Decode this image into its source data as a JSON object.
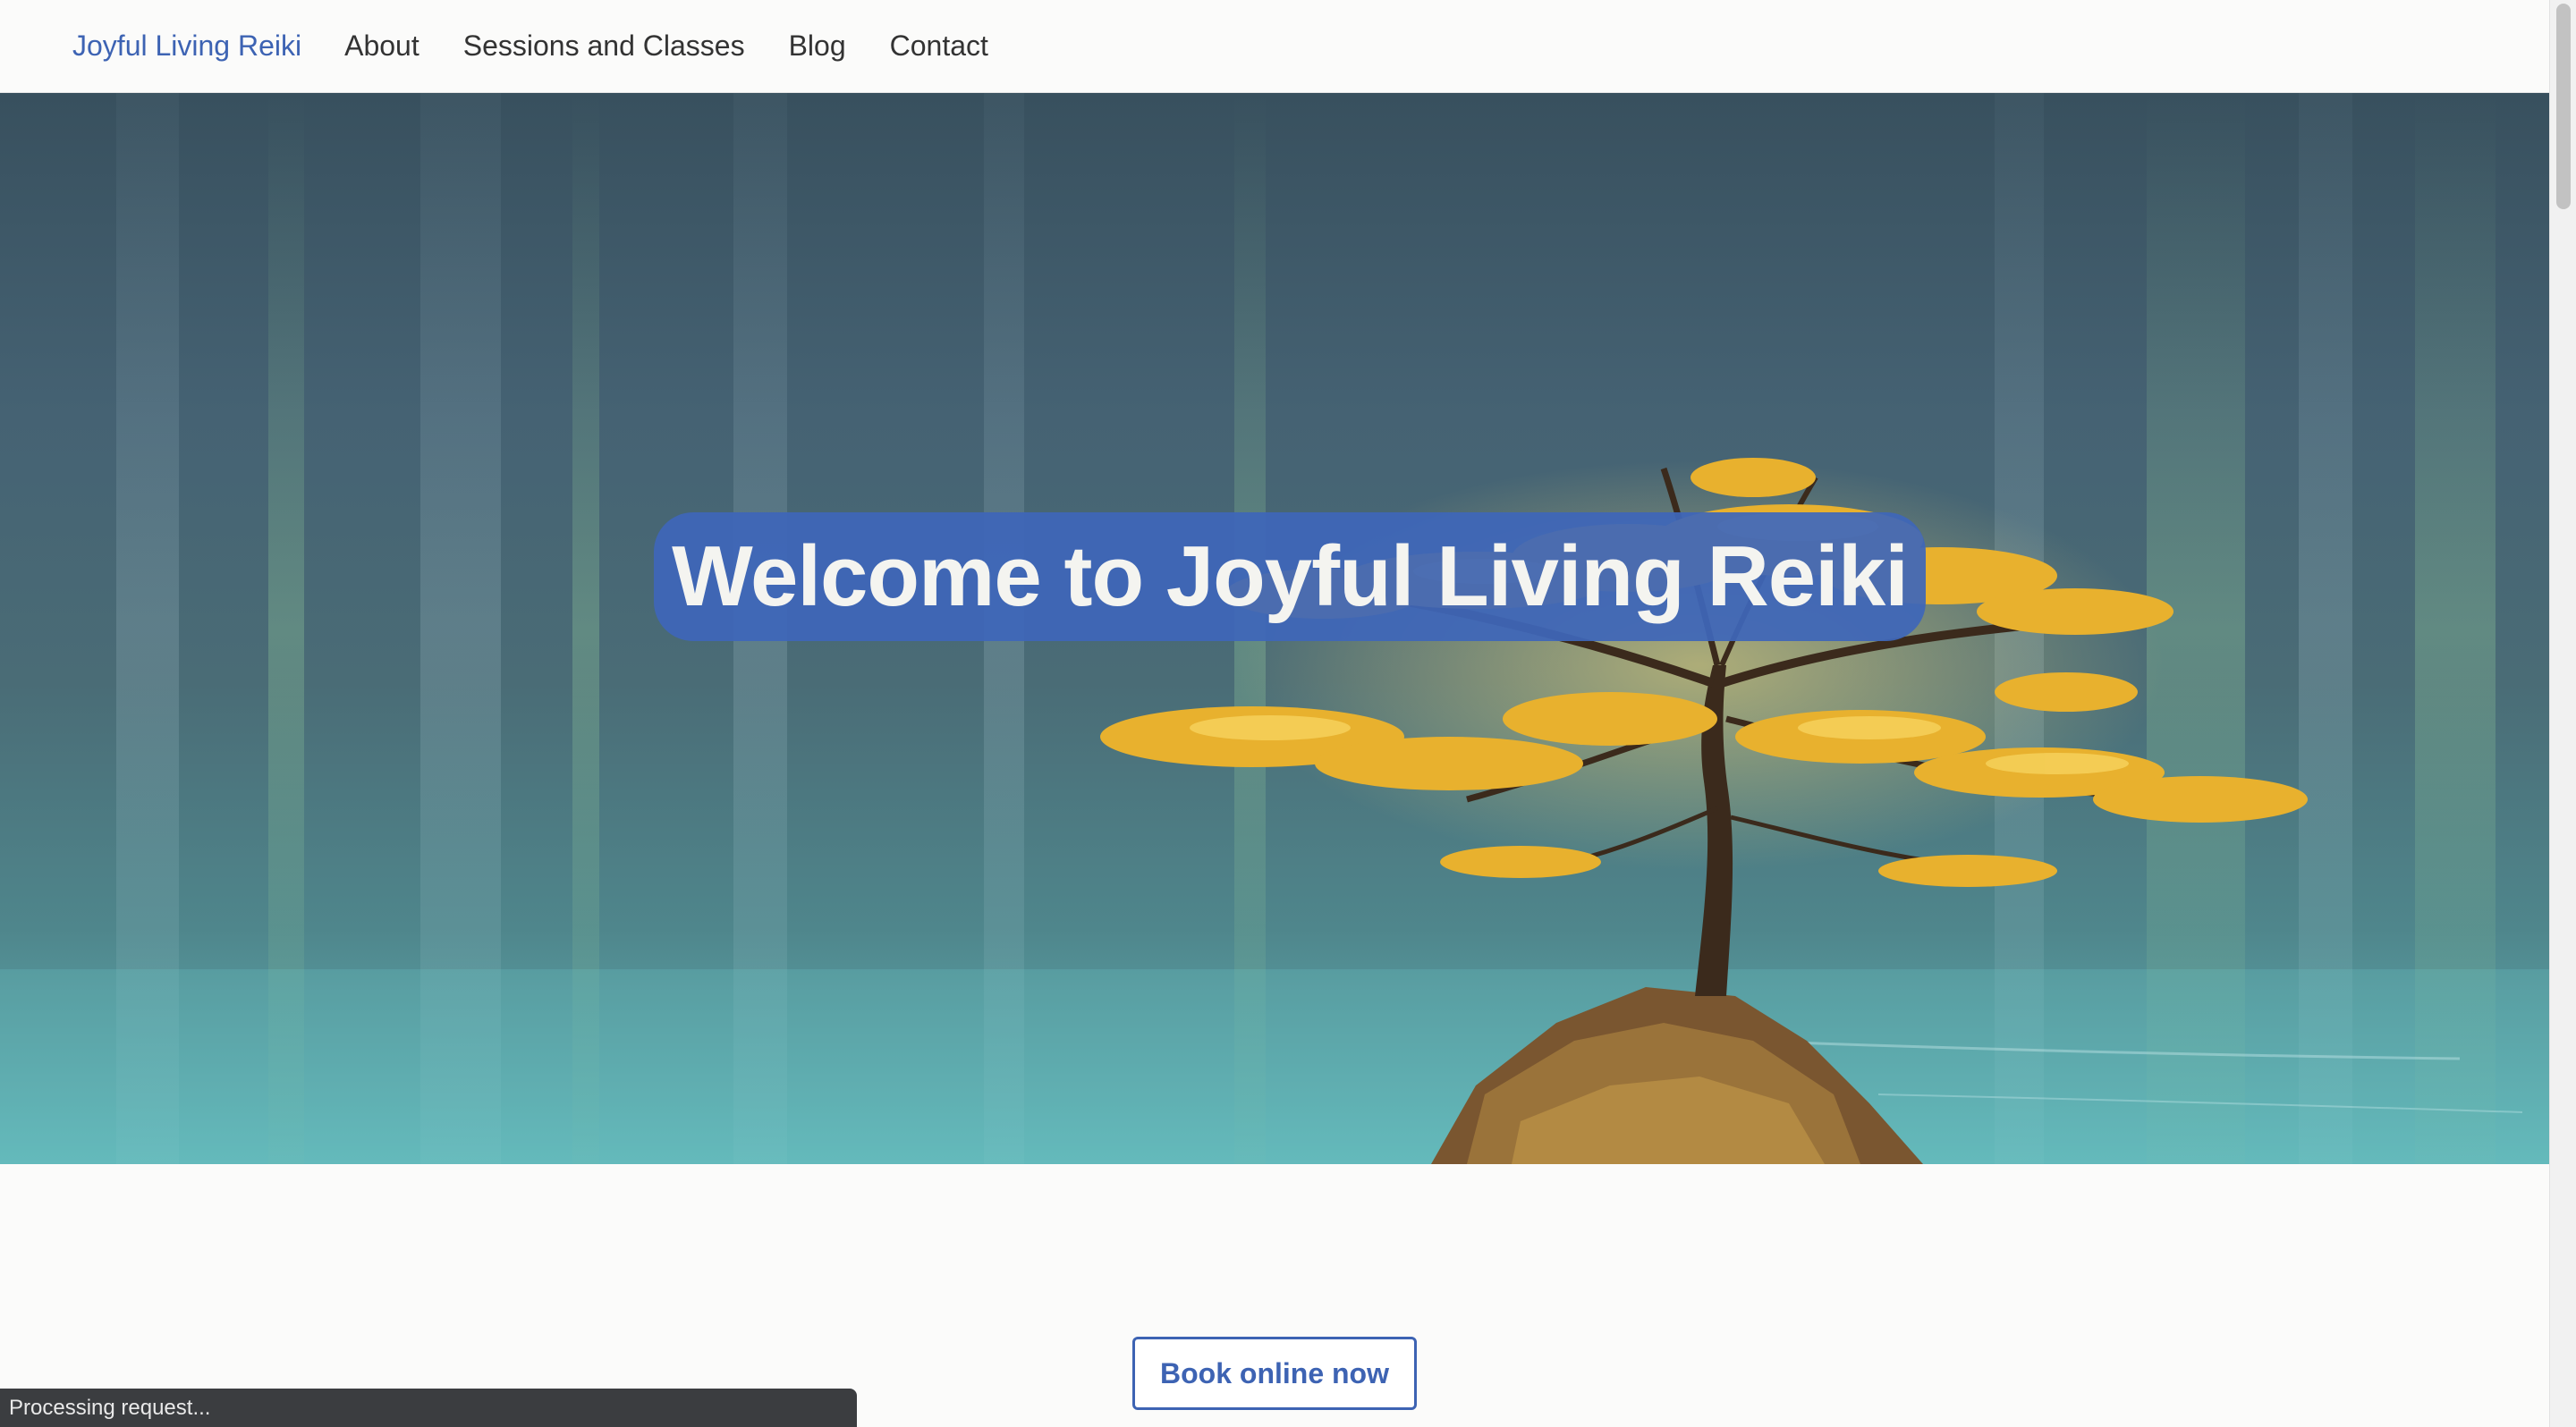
{
  "nav": {
    "brand": "Joyful Living Reiki",
    "links": [
      "About",
      "Sessions and Classes",
      "Blog",
      "Contact"
    ]
  },
  "hero": {
    "title": "Welcome to Joyful Living Reiki",
    "image": "lone-tree-on-lake"
  },
  "cta": {
    "book_label": "Book online now"
  },
  "status": {
    "text": "Processing request..."
  },
  "colors": {
    "accent": "#3d63b3",
    "title_pill": "#3e66b9",
    "status_bar": "#3b3d40"
  }
}
